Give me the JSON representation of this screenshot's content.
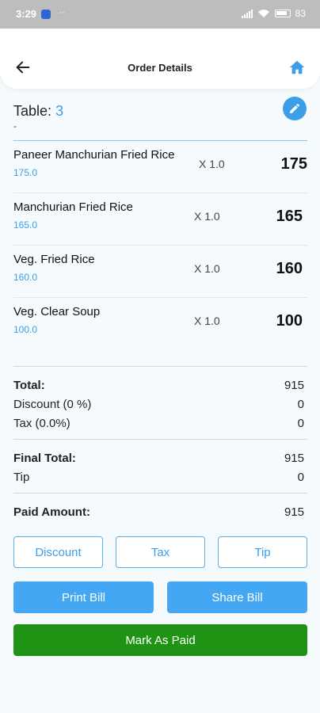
{
  "status_bar": {
    "time": "3:29",
    "dots": "··",
    "battery": "83"
  },
  "header": {
    "title": "Order Details"
  },
  "table": {
    "label": "Table:",
    "number": "3",
    "sub": "-"
  },
  "items": [
    {
      "name": "Paneer Manchurian Fried Rice",
      "price": "175.0",
      "qty": "X 1.0",
      "total": "175"
    },
    {
      "name": "Manchurian Fried Rice",
      "price": "165.0",
      "qty": "X 1.0",
      "total": "165"
    },
    {
      "name": "Veg. Fried Rice",
      "price": "160.0",
      "qty": "X 1.0",
      "total": "160"
    },
    {
      "name": "Veg. Clear Soup",
      "price": "100.0",
      "qty": "X 1.0",
      "total": "100"
    }
  ],
  "summary": {
    "total_label": "Total:",
    "total": "915",
    "discount_label": "Discount (0 %)",
    "discount": "0",
    "tax_label": "Tax (0.0%)",
    "tax": "0",
    "final_label": "Final Total:",
    "final": "915",
    "tip_label": "Tip",
    "tip": "0",
    "paid_label": "Paid Amount:",
    "paid": "915"
  },
  "buttons": {
    "discount": "Discount",
    "tax": "Tax",
    "tip": "Tip",
    "print": "Print Bill",
    "share": "Share Bill",
    "mark_paid": "Mark As Paid"
  },
  "colors": {
    "accent": "#3d9ee8",
    "primary_button": "#43a7f3",
    "paid_button": "#1f9414"
  }
}
